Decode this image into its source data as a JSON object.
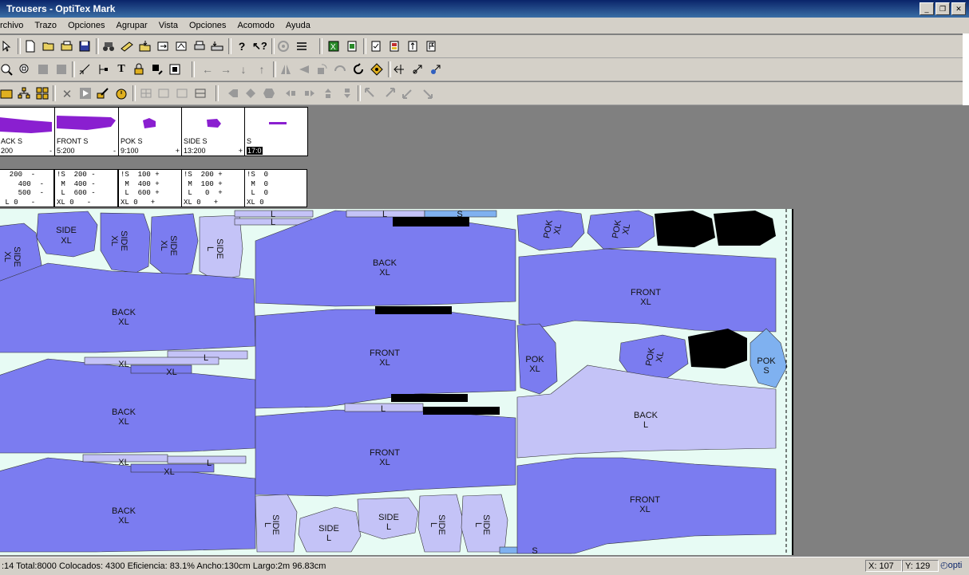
{
  "window": {
    "title": "Trousers - OptiTex Mark"
  },
  "menu": [
    "rchivo",
    "Trazo",
    "Opciones",
    "Agrupar",
    "Vista",
    "Opciones",
    "Acomodo",
    "Ayuda"
  ],
  "pieces": [
    {
      "name": "ACK S",
      "count": "200",
      "sign": "-"
    },
    {
      "name": "FRONT S",
      "count": "5:200",
      "sign": "-"
    },
    {
      "name": "POK S",
      "count": "9:100",
      "sign": "+"
    },
    {
      "name": "SIDE S",
      "count": "13:200",
      "sign": "+"
    },
    {
      "name": "S",
      "count": "17:0",
      "sign": ""
    }
  ],
  "size_tables": [
    "  200  -\n    400  -\n    500  -\n L 0   -",
    "!S  200 -\n M  400 -\n L  600 -\nXL 0   -",
    "!S  100 +\n M  400 +\n L  600 +\nXL 0   +",
    "!S  200 +\n M  100 +\n L   0  +\nXL 0   +",
    "!S  0\n M  0\n L  0\nXL 0"
  ],
  "marker_labels": {
    "back_xl": [
      "BACK",
      "XL"
    ],
    "front_xl": [
      "FRONT",
      "XL"
    ],
    "back_l": [
      "BACK",
      "L"
    ],
    "side_xl": [
      "SIDE",
      "XL"
    ],
    "side_l": [
      "SIDE",
      "L"
    ],
    "pok_xl": [
      "POK",
      "XL"
    ],
    "pok_s": [
      "POK",
      "S"
    ],
    "xl": "XL",
    "l": "L",
    "s": "S"
  },
  "status": {
    "summary": ":14  Total:8000  Colocados: 4300  Eficiencia: 83.1%  Ancho:130cm  Largo:2m 96.83cm",
    "x": "X: 107",
    "y": "Y: 129",
    "brand": "opti"
  },
  "colors": {
    "piece_xl": "#7b7cf0",
    "piece_l": "#c4c3f7",
    "piece_s": "#7fb1f0",
    "piece_dark": "#000000",
    "purple_preview": "#8a1fd0",
    "marker_bg": "#e7fbf4"
  }
}
